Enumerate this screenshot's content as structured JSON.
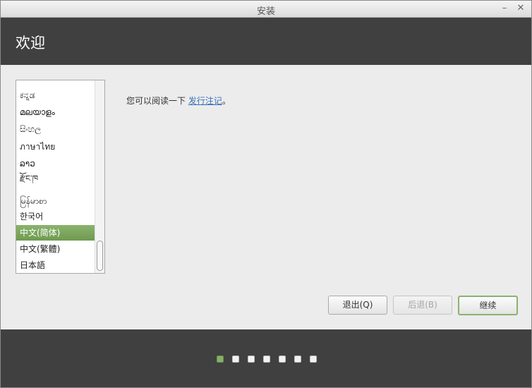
{
  "window": {
    "title": "安装"
  },
  "header": {
    "heading": "欢迎"
  },
  "languages": [
    {
      "label": "ಕನ್ನಡ",
      "selected": false
    },
    {
      "label": "മലയാളം",
      "selected": false
    },
    {
      "label": "සිංහල",
      "selected": false
    },
    {
      "label": "ภาษาไทย",
      "selected": false
    },
    {
      "label": "ລາວ",
      "selected": false
    },
    {
      "label": "རྫོང་ཁ",
      "selected": false
    },
    {
      "label": "မြန်မာစာ",
      "selected": false
    },
    {
      "label": "한국어",
      "selected": false
    },
    {
      "label": "中文(简体)",
      "selected": true
    },
    {
      "label": "中文(繁體)",
      "selected": false
    },
    {
      "label": "日本語",
      "selected": false
    }
  ],
  "main": {
    "text_before": "您可以阅读一下 ",
    "link_label": "发行注记",
    "text_after": "。"
  },
  "buttons": {
    "quit": "退出(Q)",
    "back": "后退(B)",
    "continue": "继续"
  },
  "progress": {
    "current_step": 1,
    "total_steps": 7
  },
  "colors": {
    "accent_green": "#86b06a",
    "header_bg": "#404040",
    "link": "#3b73b9"
  }
}
